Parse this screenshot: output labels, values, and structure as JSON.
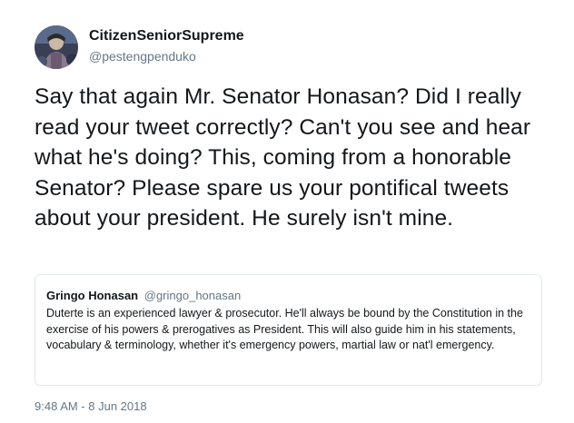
{
  "author": {
    "display_name": "CitizenSeniorSupreme",
    "handle": "@pestengpenduko",
    "avatar_icon": "profile-avatar-icon"
  },
  "tweet": {
    "text": "Say that again Mr. Senator Honasan? Did I really read your tweet correctly? Can't you see and hear what he's doing? This, coming from a honorable Senator? Please spare us your pontifical tweets about your president. He surely isn't mine.",
    "timestamp": "9:48 AM - 8 Jun 2018"
  },
  "quoted_tweet": {
    "display_name": "Gringo Honasan",
    "handle": "@gringo_honasan",
    "text": "Duterte is an experienced lawyer & prosecutor. He'll always be bound by the Constitution in the exercise of his powers & prerogatives as President. This will also guide him in his statements, vocabulary & terminology, whether it's emergency powers, martial law or nat'l emergency."
  },
  "colors": {
    "text_primary": "#14171a",
    "text_secondary": "#657786",
    "border": "#e1e8ed",
    "background": "#ffffff"
  }
}
